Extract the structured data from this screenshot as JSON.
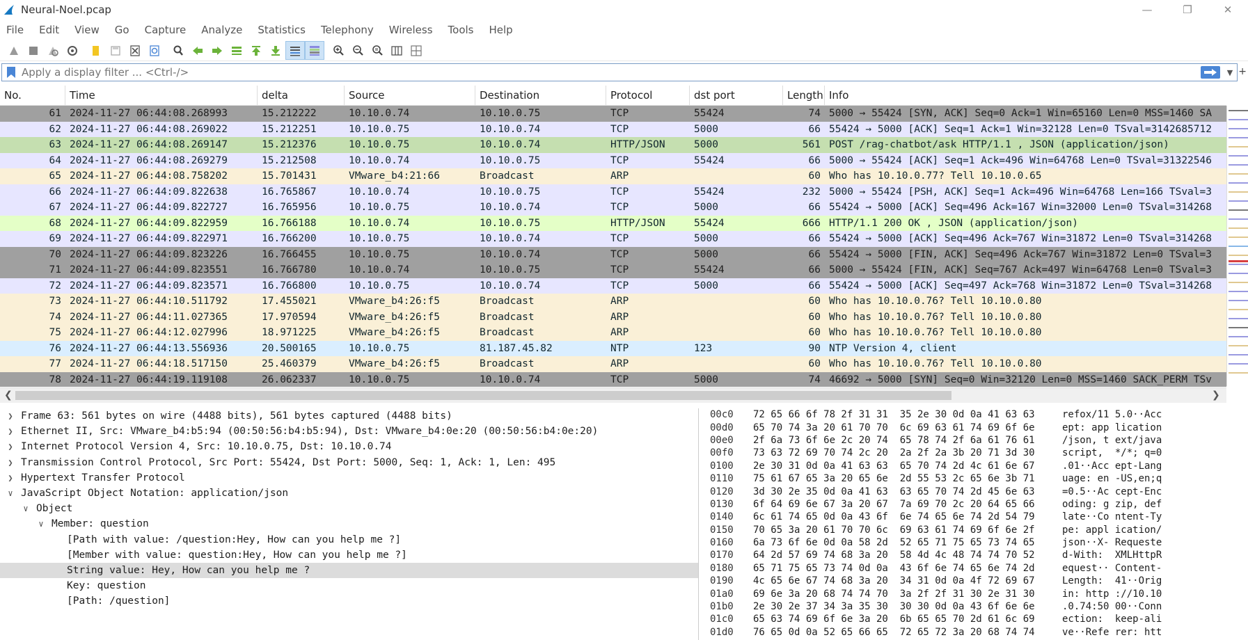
{
  "window": {
    "title": "Neural-Noel.pcap"
  },
  "menu": [
    "File",
    "Edit",
    "View",
    "Go",
    "Capture",
    "Analyze",
    "Statistics",
    "Telephony",
    "Wireless",
    "Tools",
    "Help"
  ],
  "toolbar_icons": [
    "start-capture-icon",
    "stop-capture-icon",
    "restart-capture-icon",
    "capture-options-icon",
    "open-file-icon",
    "save-file-icon",
    "close-file-icon",
    "reload-file-icon",
    "find-packet-icon",
    "go-back-icon",
    "go-forward-icon",
    "go-to-packet-icon",
    "go-first-packet-icon",
    "go-last-packet-icon",
    "auto-scroll-icon",
    "colorize-icon",
    "zoom-in-icon",
    "zoom-out-icon",
    "zoom-normal-icon",
    "resize-columns-icon",
    "layout-icon"
  ],
  "filter": {
    "placeholder": "Apply a display filter ... <Ctrl-/>"
  },
  "columns": [
    "No.",
    "Time",
    "delta",
    "Source",
    "Destination",
    "Protocol",
    "dst port",
    "Length",
    "Info"
  ],
  "colors": {
    "tcp_dark": "#a0a0a0",
    "tcp_light": "#e7e6ff",
    "http_selected": "#c5dfb0",
    "http": "#e4ffc7",
    "arp": "#faf0d7",
    "ntp": "#daeeff",
    "hex_highlight": "#a8c8e8"
  },
  "packets": [
    {
      "no": "61",
      "time": "2024-11-27 06:44:08.268993",
      "delta": "15.212222",
      "src": "10.10.0.74",
      "dst": "10.10.0.75",
      "proto": "TCP",
      "port": "55424",
      "len": "74",
      "info": "5000 → 55424 [SYN, ACK] Seq=0 Ack=1 Win=65160 Len=0 MSS=1460 SA",
      "style": "tcp_dark",
      "fg": "#1e1e1e"
    },
    {
      "no": "62",
      "time": "2024-11-27 06:44:08.269022",
      "delta": "15.212251",
      "src": "10.10.0.75",
      "dst": "10.10.0.74",
      "proto": "TCP",
      "port": "5000",
      "len": "66",
      "info": "55424 → 5000 [ACK] Seq=1 Ack=1 Win=32128 Len=0 TSval=3142685712",
      "style": "tcp_light",
      "fg": "#12272e"
    },
    {
      "no": "63",
      "time": "2024-11-27 06:44:08.269147",
      "delta": "15.212376",
      "src": "10.10.0.75",
      "dst": "10.10.0.74",
      "proto": "HTTP/JSON",
      "port": "5000",
      "len": "561",
      "info": "POST /rag-chatbot/ask HTTP/1.1 , JSON (application/json)",
      "style": "http_selected",
      "fg": "#12272e"
    },
    {
      "no": "64",
      "time": "2024-11-27 06:44:08.269279",
      "delta": "15.212508",
      "src": "10.10.0.74",
      "dst": "10.10.0.75",
      "proto": "TCP",
      "port": "55424",
      "len": "66",
      "info": "5000 → 55424 [ACK] Seq=1 Ack=496 Win=64768 Len=0 TSval=31322546",
      "style": "tcp_light",
      "fg": "#12272e"
    },
    {
      "no": "65",
      "time": "2024-11-27 06:44:08.758202",
      "delta": "15.701431",
      "src": "VMware_b4:21:66",
      "dst": "Broadcast",
      "proto": "ARP",
      "port": "",
      "len": "60",
      "info": "Who has 10.10.0.77? Tell 10.10.0.65",
      "style": "arp",
      "fg": "#12272e"
    },
    {
      "no": "66",
      "time": "2024-11-27 06:44:09.822638",
      "delta": "16.765867",
      "src": "10.10.0.74",
      "dst": "10.10.0.75",
      "proto": "TCP",
      "port": "55424",
      "len": "232",
      "info": "5000 → 55424 [PSH, ACK] Seq=1 Ack=496 Win=64768 Len=166 TSval=3",
      "style": "tcp_light",
      "fg": "#12272e"
    },
    {
      "no": "67",
      "time": "2024-11-27 06:44:09.822727",
      "delta": "16.765956",
      "src": "10.10.0.75",
      "dst": "10.10.0.74",
      "proto": "TCP",
      "port": "5000",
      "len": "66",
      "info": "55424 → 5000 [ACK] Seq=496 Ack=167 Win=32000 Len=0 TSval=314268",
      "style": "tcp_light",
      "fg": "#12272e"
    },
    {
      "no": "68",
      "time": "2024-11-27 06:44:09.822959",
      "delta": "16.766188",
      "src": "10.10.0.74",
      "dst": "10.10.0.75",
      "proto": "HTTP/JSON",
      "port": "55424",
      "len": "666",
      "info": "HTTP/1.1 200 OK , JSON (application/json)",
      "style": "http",
      "fg": "#12272e"
    },
    {
      "no": "69",
      "time": "2024-11-27 06:44:09.822971",
      "delta": "16.766200",
      "src": "10.10.0.75",
      "dst": "10.10.0.74",
      "proto": "TCP",
      "port": "5000",
      "len": "66",
      "info": "55424 → 5000 [ACK] Seq=496 Ack=767 Win=31872 Len=0 TSval=314268",
      "style": "tcp_light",
      "fg": "#12272e"
    },
    {
      "no": "70",
      "time": "2024-11-27 06:44:09.823226",
      "delta": "16.766455",
      "src": "10.10.0.75",
      "dst": "10.10.0.74",
      "proto": "TCP",
      "port": "5000",
      "len": "66",
      "info": "55424 → 5000 [FIN, ACK] Seq=496 Ack=767 Win=31872 Len=0 TSval=3",
      "style": "tcp_dark",
      "fg": "#1e1e1e"
    },
    {
      "no": "71",
      "time": "2024-11-27 06:44:09.823551",
      "delta": "16.766780",
      "src": "10.10.0.74",
      "dst": "10.10.0.75",
      "proto": "TCP",
      "port": "55424",
      "len": "66",
      "info": "5000 → 55424 [FIN, ACK] Seq=767 Ack=497 Win=64768 Len=0 TSval=3",
      "style": "tcp_dark",
      "fg": "#1e1e1e"
    },
    {
      "no": "72",
      "time": "2024-11-27 06:44:09.823571",
      "delta": "16.766800",
      "src": "10.10.0.75",
      "dst": "10.10.0.74",
      "proto": "TCP",
      "port": "5000",
      "len": "66",
      "info": "55424 → 5000 [ACK] Seq=497 Ack=768 Win=31872 Len=0 TSval=314268",
      "style": "tcp_light",
      "fg": "#12272e"
    },
    {
      "no": "73",
      "time": "2024-11-27 06:44:10.511792",
      "delta": "17.455021",
      "src": "VMware_b4:26:f5",
      "dst": "Broadcast",
      "proto": "ARP",
      "port": "",
      "len": "60",
      "info": "Who has 10.10.0.76? Tell 10.10.0.80",
      "style": "arp",
      "fg": "#12272e"
    },
    {
      "no": "74",
      "time": "2024-11-27 06:44:11.027365",
      "delta": "17.970594",
      "src": "VMware_b4:26:f5",
      "dst": "Broadcast",
      "proto": "ARP",
      "port": "",
      "len": "60",
      "info": "Who has 10.10.0.76? Tell 10.10.0.80",
      "style": "arp",
      "fg": "#12272e"
    },
    {
      "no": "75",
      "time": "2024-11-27 06:44:12.027996",
      "delta": "18.971225",
      "src": "VMware_b4:26:f5",
      "dst": "Broadcast",
      "proto": "ARP",
      "port": "",
      "len": "60",
      "info": "Who has 10.10.0.76? Tell 10.10.0.80",
      "style": "arp",
      "fg": "#12272e"
    },
    {
      "no": "76",
      "time": "2024-11-27 06:44:13.556936",
      "delta": "20.500165",
      "src": "10.10.0.75",
      "dst": "81.187.45.82",
      "proto": "NTP",
      "port": "123",
      "len": "90",
      "info": "NTP Version 4, client",
      "style": "ntp",
      "fg": "#12272e"
    },
    {
      "no": "77",
      "time": "2024-11-27 06:44:18.517150",
      "delta": "25.460379",
      "src": "VMware_b4:26:f5",
      "dst": "Broadcast",
      "proto": "ARP",
      "port": "",
      "len": "60",
      "info": "Who has 10.10.0.76? Tell 10.10.0.80",
      "style": "arp",
      "fg": "#12272e"
    },
    {
      "no": "78",
      "time": "2024-11-27 06:44:19.119108",
      "delta": "26.062337",
      "src": "10.10.0.75",
      "dst": "10.10.0.74",
      "proto": "TCP",
      "port": "5000",
      "len": "74",
      "info": "46692 → 5000 [SYN] Seq=0 Win=32120 Len=0 MSS=1460 SACK_PERM TSv",
      "style": "tcp_dark",
      "fg": "#1e1e1e"
    }
  ],
  "details": [
    {
      "text": "Frame 63: 561 bytes on wire (4488 bits), 561 bytes captured (4488 bits)",
      "level": 0,
      "toggle": "collapsed",
      "selected": false
    },
    {
      "text": "Ethernet II, Src: VMware_b4:b5:94 (00:50:56:b4:b5:94), Dst: VMware_b4:0e:20 (00:50:56:b4:0e:20)",
      "level": 0,
      "toggle": "collapsed",
      "selected": false
    },
    {
      "text": "Internet Protocol Version 4, Src: 10.10.0.75, Dst: 10.10.0.74",
      "level": 0,
      "toggle": "collapsed",
      "selected": false
    },
    {
      "text": "Transmission Control Protocol, Src Port: 55424, Dst Port: 5000, Seq: 1, Ack: 1, Len: 495",
      "level": 0,
      "toggle": "collapsed",
      "selected": false
    },
    {
      "text": "Hypertext Transfer Protocol",
      "level": 0,
      "toggle": "collapsed",
      "selected": false
    },
    {
      "text": "JavaScript Object Notation: application/json",
      "level": 0,
      "toggle": "expanded",
      "selected": false
    },
    {
      "text": "Object",
      "level": 1,
      "toggle": "expanded",
      "selected": false
    },
    {
      "text": "Member: question",
      "level": 2,
      "toggle": "expanded",
      "selected": false
    },
    {
      "text": "[Path with value: /question:Hey, How can you help me ?]",
      "level": 3,
      "toggle": "none",
      "selected": false
    },
    {
      "text": "[Member with value: question:Hey, How can you help me ?]",
      "level": 3,
      "toggle": "none",
      "selected": false
    },
    {
      "text": "String value: Hey, How can you help me ?",
      "level": 3,
      "toggle": "none",
      "selected": true
    },
    {
      "text": "Key: question",
      "level": 3,
      "toggle": "none",
      "selected": false
    },
    {
      "text": "[Path: /question]",
      "level": 3,
      "toggle": "none",
      "selected": false
    }
  ],
  "bytes": [
    {
      "off": "00c0",
      "hex": "72 65 66 6f 78 2f 31 31  35 2e 30 0d 0a 41 63 63",
      "ascii": "refox/11 5.0··Acc"
    },
    {
      "off": "00d0",
      "hex": "65 70 74 3a 20 61 70 70  6c 69 63 61 74 69 6f 6e",
      "ascii": "ept: app lication"
    },
    {
      "off": "00e0",
      "hex": "2f 6a 73 6f 6e 2c 20 74  65 78 74 2f 6a 61 76 61",
      "ascii": "/json, t ext/java"
    },
    {
      "off": "00f0",
      "hex": "73 63 72 69 70 74 2c 20  2a 2f 2a 3b 20 71 3d 30",
      "ascii": "script,  */*; q=0"
    },
    {
      "off": "0100",
      "hex": "2e 30 31 0d 0a 41 63 63  65 70 74 2d 4c 61 6e 67",
      "ascii": ".01··Acc ept-Lang"
    },
    {
      "off": "0110",
      "hex": "75 61 67 65 3a 20 65 6e  2d 55 53 2c 65 6e 3b 71",
      "ascii": "uage: en -US,en;q"
    },
    {
      "off": "0120",
      "hex": "3d 30 2e 35 0d 0a 41 63  63 65 70 74 2d 45 6e 63",
      "ascii": "=0.5··Ac cept-Enc"
    },
    {
      "off": "0130",
      "hex": "6f 64 69 6e 67 3a 20 67  7a 69 70 2c 20 64 65 66",
      "ascii": "oding: g zip, def"
    },
    {
      "off": "0140",
      "hex": "6c 61 74 65 0d 0a 43 6f  6e 74 65 6e 74 2d 54 79",
      "ascii": "late··Co ntent-Ty"
    },
    {
      "off": "0150",
      "hex": "70 65 3a 20 61 70 70 6c  69 63 61 74 69 6f 6e 2f",
      "ascii": "pe: appl ication/"
    },
    {
      "off": "0160",
      "hex": "6a 73 6f 6e 0d 0a 58 2d  52 65 71 75 65 73 74 65",
      "ascii": "json··X- Requeste"
    },
    {
      "off": "0170",
      "hex": "64 2d 57 69 74 68 3a 20  58 4d 4c 48 74 74 70 52",
      "ascii": "d-With:  XMLHttpR"
    },
    {
      "off": "0180",
      "hex": "65 71 75 65 73 74 0d 0a  43 6f 6e 74 65 6e 74 2d",
      "ascii": "equest·· Content-"
    },
    {
      "off": "0190",
      "hex": "4c 65 6e 67 74 68 3a 20  34 31 0d 0a 4f 72 69 67",
      "ascii": "Length:  41··Orig"
    },
    {
      "off": "01a0",
      "hex": "69 6e 3a 20 68 74 74 70  3a 2f 2f 31 30 2e 31 30",
      "ascii": "in: http ://10.10"
    },
    {
      "off": "01b0",
      "hex": "2e 30 2e 37 34 3a 35 30  30 30 0d 0a 43 6f 6e 6e",
      "ascii": ".0.74:50 00··Conn"
    },
    {
      "off": "01c0",
      "hex": "65 63 74 69 6f 6e 3a 20  6b 65 65 70 2d 61 6c 69",
      "ascii": "ection:  keep-ali"
    },
    {
      "off": "01d0",
      "hex": "76 65 0d 0a 52 65 66 65  72 65 72 3a 20 68 74 74",
      "ascii": "ve··Refe rer: htt"
    }
  ]
}
